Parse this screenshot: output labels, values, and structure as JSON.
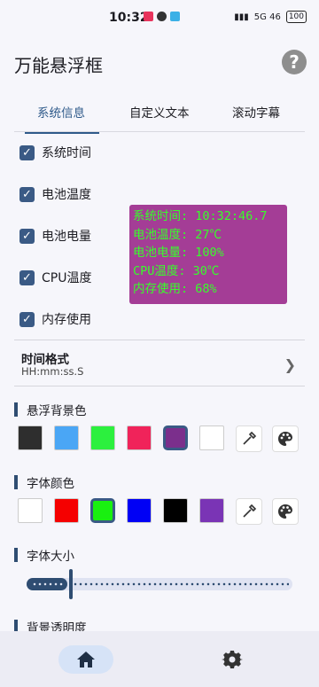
{
  "status_bar": {
    "time": "10:32",
    "right_text": "5G 46",
    "battery": "100"
  },
  "app": {
    "title": "万能悬浮框",
    "help_icon": "?"
  },
  "tabs": [
    {
      "label": "系统信息",
      "active": true
    },
    {
      "label": "自定义文本",
      "active": false
    },
    {
      "label": "滚动字幕",
      "active": false
    }
  ],
  "checkboxes": [
    {
      "label": "系统时间",
      "checked": true
    },
    {
      "label": "电池温度",
      "checked": true
    },
    {
      "label": "电池电量",
      "checked": true
    },
    {
      "label": "CPU温度",
      "checked": true
    },
    {
      "label": "内存使用",
      "checked": true
    }
  ],
  "overlay": {
    "lines": [
      "系统时间: 10:32:46.7",
      "电池温度: 27℃",
      "电池电量: 100%",
      "CPU温度: 30℃",
      "内存使用: 68%"
    ],
    "background": "#a43d96",
    "text_color": "#36ff29"
  },
  "time_format": {
    "title": "时间格式",
    "value": "HH:mm:ss.S"
  },
  "bg_color": {
    "title": "悬浮背景色",
    "swatches": [
      "#2e2e2e",
      "#4aa6f5",
      "#2cf03e",
      "#f0235a",
      "#7b2f8c",
      "#ffffff"
    ],
    "selected": 4
  },
  "font_color": {
    "title": "字体颜色",
    "swatches": [
      "#ffffff",
      "#f50000",
      "#19f010",
      "#0000f5",
      "#000000",
      "#7a34b5"
    ],
    "selected": 2
  },
  "font_size": {
    "title": "字体大小",
    "value_fraction": 0.16
  },
  "bg_opacity": {
    "title": "背景透明度"
  },
  "bottom_nav": [
    {
      "icon": "home-icon",
      "active": true
    },
    {
      "icon": "gear-icon",
      "active": false
    }
  ]
}
